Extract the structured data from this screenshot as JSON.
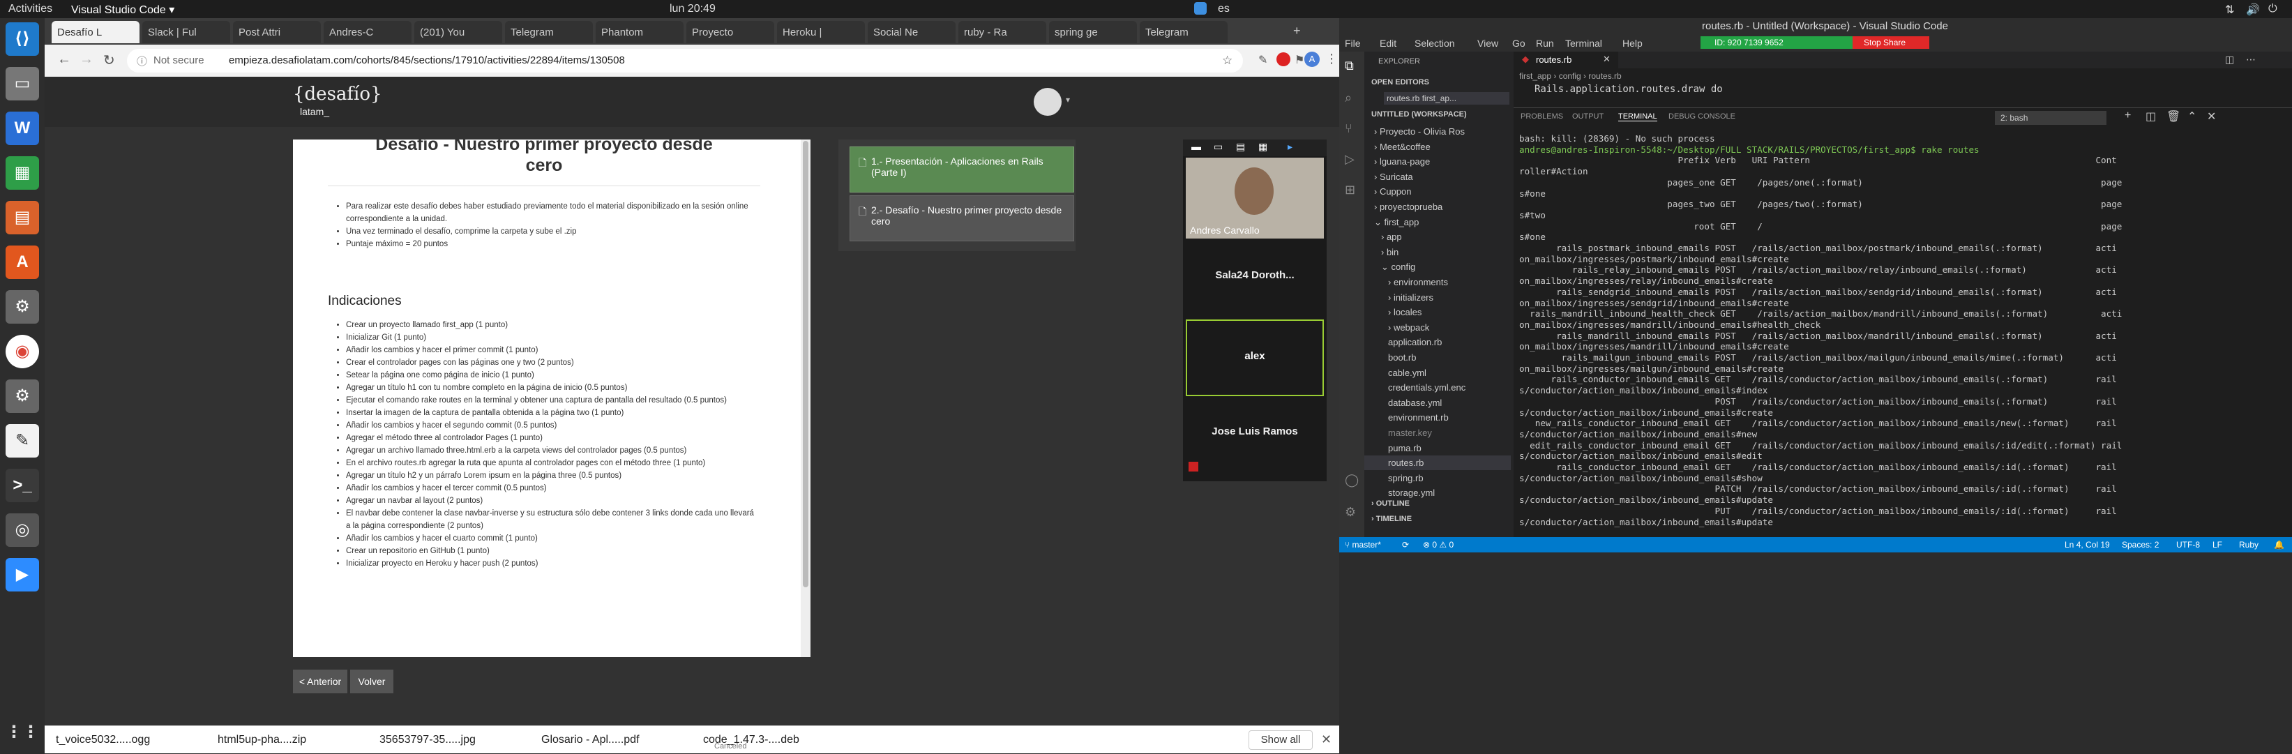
{
  "topbar": {
    "activities": "Activities",
    "app": "Visual Studio Code ▾",
    "clock": "lun 20:49",
    "lang": "es"
  },
  "chrome": {
    "tabs": [
      "Desafío L",
      "Slack | Ful",
      "Post Attri",
      "Andres-C",
      "(201) You",
      "Telegram",
      "Phantom",
      "Proyecto",
      "Heroku |",
      "Social Ne",
      "ruby - Ra",
      "spring ge",
      "Telegram"
    ],
    "url_secure": "Not secure",
    "url": "empieza.desafiolatam.com/cohorts/845/sections/17910/activities/22894/items/130508",
    "avatar_initial": "A",
    "logo": "{desafío}",
    "logo_sub": "latam_",
    "doc_title_1": "Desafío - Nuestro primer proyecto desde",
    "doc_title_2": "cero",
    "intro_items": [
      "Para realizar este desafío debes haber estudiado previamente todo el material disponibilizado en la sesión online correspondiente a la unidad.",
      "Una vez terminado el desafío, comprime la carpeta y sube el .zip",
      "Puntaje máximo = 20 puntos"
    ],
    "section_heading": "Indicaciones",
    "items": [
      "Crear un proyecto llamado first_app (1 punto)",
      "Inicializar Git (1 punto)",
      "Añadir los cambios y hacer el primer commit (1 punto)",
      "Crear el controlador pages con las páginas one y two (2 puntos)",
      "Setear la página one como página de inicio (1 punto)",
      "Agregar un título h1 con tu nombre completo en la página de inicio (0.5 puntos)",
      "Ejecutar el comando rake routes en la terminal y obtener una captura de pantalla del resultado (0.5 puntos)",
      "Insertar la imagen de la captura de pantalla obtenida a la página two (1 punto)",
      "Añadir los cambios y hacer el segundo commit (0.5 puntos)",
      "Agregar el método three al controlador Pages (1 punto)",
      "Agregar un archivo llamado three.html.erb a la carpeta views del controlador pages (0.5 puntos)",
      "En el archivo routes.rb agregar la ruta que apunta al controlador pages con el método three (1 punto)",
      "Agregar un título h2 y un párrafo Lorem ipsum en la página three (0.5 puntos)",
      "Añadir los cambios y hacer el tercer commit (0.5 puntos)",
      "Agregar un navbar al layout (2 puntos)",
      "El navbar debe contener la clase navbar-inverse y su estructura sólo debe contener 3 links donde cada uno llevará a la página correspondiente (2 puntos)",
      "Añadir los cambios y hacer el cuarto commit (1 punto)",
      "Crear un repositorio en GitHub (1 punto)",
      "Inicializar proyecto en Heroku y hacer push (2 puntos)"
    ],
    "side_items": [
      "1.- Presentación - Aplicaciones en Rails (Parte I)",
      "2.- Desafío - Nuestro primer proyecto desde cero"
    ],
    "prev_button": "< Anterior",
    "back_button": "Volver",
    "video": {
      "p1": "Andres Carvallo",
      "p2": "Sala24 Doroth...",
      "p3": "alex",
      "p4": "Jose Luis Ramos"
    },
    "downloads": [
      "t_voice5032.....ogg",
      "html5up-pha....zip",
      "35653797-35.....jpg",
      "Glosario - Apl.....pdf",
      "code_1.47.3-....deb"
    ],
    "dl_canceled": "Canceled",
    "show_all": "Show all"
  },
  "vscode": {
    "title": "routes.rb - Untitled (Workspace) - Visual Studio Code",
    "menu": [
      "File",
      "Edit",
      "Selection",
      "View",
      "Go",
      "Run",
      "Terminal",
      "Help"
    ],
    "share_id": "ID: 920 7139 9652",
    "stop_share": "Stop Share",
    "explorer": "EXPLORER",
    "open_editors": "OPEN EDITORS",
    "open_file": "routes.rb  first_ap...",
    "workspace": "UNTITLED (WORKSPACE)",
    "tree": [
      "› Proyecto - Olivia Ros",
      "› Meet&coffee",
      "› lguana-page",
      "› Suricata",
      "› Cuppon",
      "› proyectoprueba",
      "⌄ first_app",
      "› app",
      "› bin",
      "⌄ config",
      "› environments",
      "› initializers",
      "› locales",
      "› webpack",
      "application.rb",
      "boot.rb",
      "cable.yml",
      "credentials.yml.enc",
      "database.yml",
      "environment.rb",
      "master.key",
      "puma.rb",
      "routes.rb",
      "spring.rb",
      "storage.yml"
    ],
    "outline": "› OUTLINE",
    "timeline": "› TIMELINE",
    "editor_tab": "routes.rb",
    "breadcrumb": "first_app › config › routes.rb",
    "code_line": "Rails.application.routes.draw do",
    "panel_tabs": [
      "PROBLEMS",
      "OUTPUT",
      "TERMINAL",
      "DEBUG CONSOLE"
    ],
    "terminal_select": "2: bash",
    "terminal": [
      "bash: kill: (28369) - No such process",
      "andres@andres-Inspiron-5548:~/Desktop/FULL STACK/RAILS/PROYECTOS/first_app$ rake routes",
      "                              Prefix Verb   URI Pattern                                                      Cont",
      "roller#Action",
      "                            pages_one GET    /pages/one(.:format)                                             page",
      "s#one",
      "                            pages_two GET    /pages/two(.:format)                                             page",
      "s#two",
      "                                 root GET    /                                                                page",
      "s#one",
      "       rails_postmark_inbound_emails POST   /rails/action_mailbox/postmark/inbound_emails(.:format)          acti",
      "on_mailbox/ingresses/postmark/inbound_emails#create",
      "          rails_relay_inbound_emails POST   /rails/action_mailbox/relay/inbound_emails(.:format)             acti",
      "on_mailbox/ingresses/relay/inbound_emails#create",
      "       rails_sendgrid_inbound_emails POST   /rails/action_mailbox/sendgrid/inbound_emails(.:format)          acti",
      "on_mailbox/ingresses/sendgrid/inbound_emails#create",
      "  rails_mandrill_inbound_health_check GET    /rails/action_mailbox/mandrill/inbound_emails(.:format)          acti",
      "on_mailbox/ingresses/mandrill/inbound_emails#health_check",
      "       rails_mandrill_inbound_emails POST   /rails/action_mailbox/mandrill/inbound_emails(.:format)          acti",
      "on_mailbox/ingresses/mandrill/inbound_emails#create",
      "        rails_mailgun_inbound_emails POST   /rails/action_mailbox/mailgun/inbound_emails/mime(.:format)      acti",
      "on_mailbox/ingresses/mailgun/inbound_emails#create",
      "      rails_conductor_inbound_emails GET    /rails/conductor/action_mailbox/inbound_emails(.:format)         rail",
      "s/conductor/action_mailbox/inbound_emails#index",
      "                                     POST   /rails/conductor/action_mailbox/inbound_emails(.:format)         rail",
      "s/conductor/action_mailbox/inbound_emails#create",
      "   new_rails_conductor_inbound_email GET    /rails/conductor/action_mailbox/inbound_emails/new(.:format)     rail",
      "s/conductor/action_mailbox/inbound_emails#new",
      "  edit_rails_conductor_inbound_email GET    /rails/conductor/action_mailbox/inbound_emails/:id/edit(.:format) rail",
      "s/conductor/action_mailbox/inbound_emails#edit",
      "       rails_conductor_inbound_email GET    /rails/conductor/action_mailbox/inbound_emails/:id(.:format)     rail",
      "s/conductor/action_mailbox/inbound_emails#show",
      "                                     PATCH  /rails/conductor/action_mailbox/inbound_emails/:id(.:format)     rail",
      "s/conductor/action_mailbox/inbound_emails#update",
      "                                     PUT    /rails/conductor/action_mailbox/inbound_emails/:id(.:format)     rail",
      "s/conductor/action_mailbox/inbound_emails#update"
    ],
    "status": {
      "branch": "⑂ master*",
      "sync": "⟳",
      "errors": "⊗ 0 ⚠ 0",
      "pos": "Ln 4, Col 19",
      "spaces": "Spaces: 2",
      "enc": "UTF-8",
      "eol": "LF",
      "lang": "Ruby"
    }
  }
}
